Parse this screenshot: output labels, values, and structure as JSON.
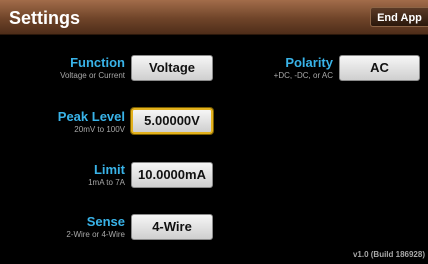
{
  "header": {
    "title": "Settings",
    "end_app_label": "End App"
  },
  "function": {
    "label": "Function",
    "sub": "Voltage or Current",
    "value": "Voltage"
  },
  "polarity": {
    "label": "Polarity",
    "sub": "+DC, -DC, or AC",
    "value": "AC"
  },
  "peak_level": {
    "label": "Peak Level",
    "sub": "20mV to 100V",
    "value": "5.00000V"
  },
  "limit": {
    "label": "Limit",
    "sub": "1mA to 7A",
    "value": "10.0000mA"
  },
  "sense": {
    "label": "Sense",
    "sub": "2-Wire or 4-Wire",
    "value": "4-Wire"
  },
  "footer": {
    "version": "v1.0 (Build 186928)"
  },
  "colors": {
    "accent": "#39b3e8",
    "focus": "#e3b11d",
    "header": "#6f4429"
  }
}
